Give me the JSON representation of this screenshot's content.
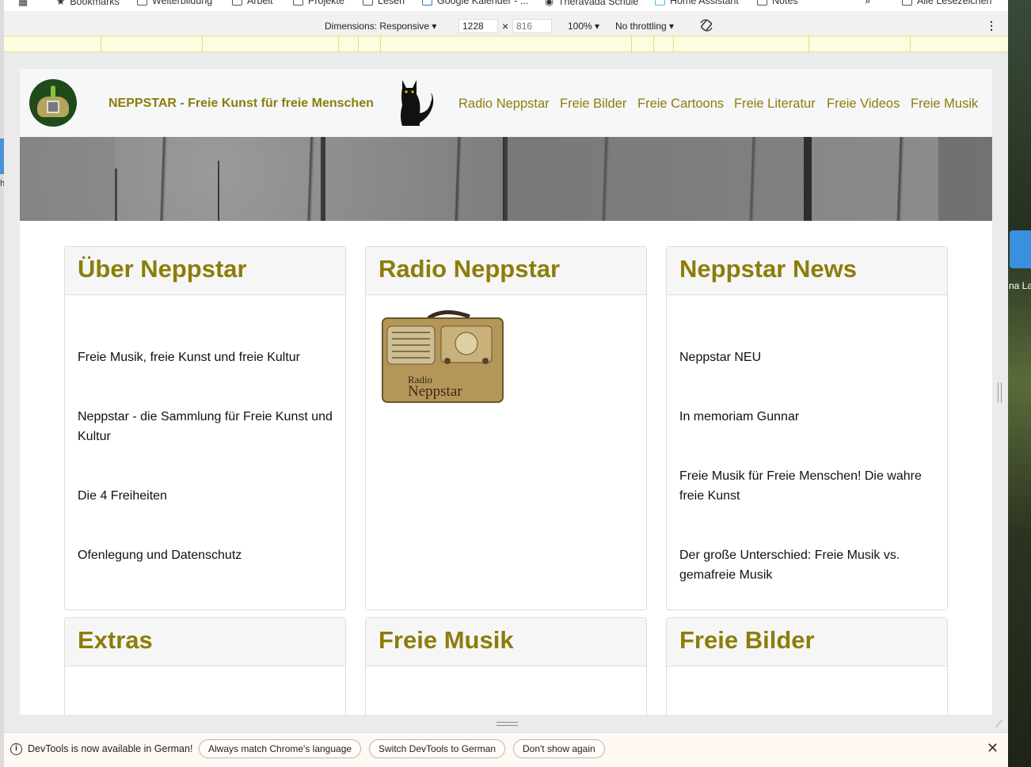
{
  "bookmarks_bar": {
    "items": [
      "Bookmarks",
      "Weiterbildung",
      "Arbeit",
      "Projekte",
      "Lesen",
      "Google Kalender - ...",
      "Theravada Schule",
      "Home Assistant",
      "Notes",
      "Alle Lesezeichen"
    ],
    "overflow": "»"
  },
  "devtools_toolbar": {
    "dimensions_label": "Dimensions: Responsive ▾",
    "width_value": "1228",
    "times": "×",
    "height_value": "816",
    "zoom": "100% ▾",
    "throttle": "No throttling ▾",
    "kebab": "⋮"
  },
  "site": {
    "title": "NEPPSTAR - Freie Kunst für freie Menschen",
    "nav": [
      "Radio Neppstar",
      "Freie Bilder",
      "Freie Cartoons",
      "Freie Literatur",
      "Freie Videos",
      "Freie Musik"
    ]
  },
  "cards": {
    "about": {
      "title": "Über Neppstar",
      "links": [
        "Freie Musik, freie Kunst und freie Kultur",
        "Neppstar - die Sammlung für Freie Kunst und Kultur",
        "Die 4 Freiheiten",
        "Ofenlegung und Datenschutz"
      ]
    },
    "radio": {
      "title": "Radio Neppstar",
      "image_text_small": "Radio",
      "image_text_big": "Neppstar"
    },
    "news": {
      "title": "Neppstar News",
      "links": [
        "Neppstar NEU",
        "In memoriam Gunnar",
        "Freie Musik für Freie Menschen! Die wahre freie Kunst",
        "Der große Unterschied: Freie Musik vs. gemafreie Musik"
      ]
    },
    "extras": {
      "title": "Extras"
    },
    "music": {
      "title": "Freie Musik"
    },
    "images": {
      "title": "Freie Bilder"
    }
  },
  "infobar": {
    "icon": "i",
    "message": "DevTools is now available in German!",
    "buttons": [
      "Always match Chrome's language",
      "Switch DevTools to German",
      "Don't show again"
    ],
    "close": "✕"
  },
  "desktop": {
    "right_label": "na La",
    "left_label": "h"
  },
  "colors": {
    "accent": "#8c7d0a",
    "page_bg": "#ffffff",
    "header_bg": "#f5f7f8"
  }
}
